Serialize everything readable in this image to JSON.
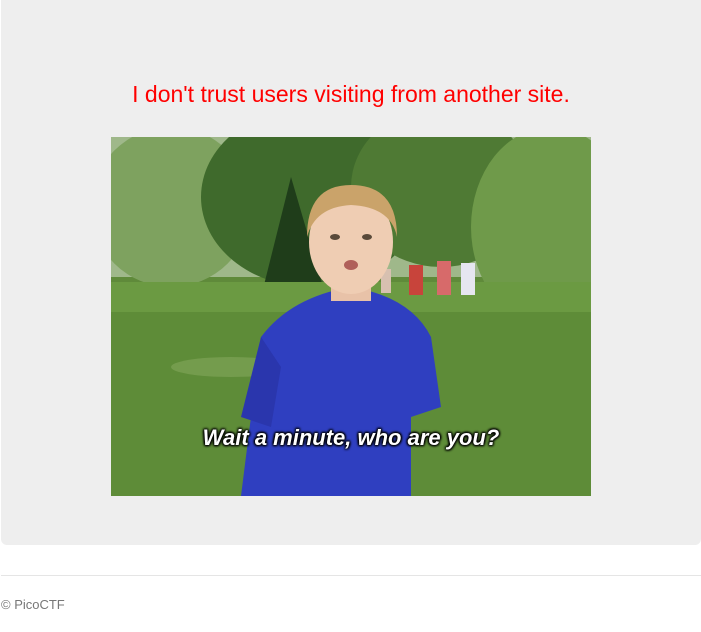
{
  "main": {
    "message": "I don't trust users visiting from another site.",
    "message_color": "#ff0000",
    "image": {
      "subject": "boy in blue t-shirt standing in a grassy field, other kids in background",
      "caption": "Wait a minute, who are you?"
    }
  },
  "footer": {
    "text": "© PicoCTF"
  },
  "colors": {
    "panel_bg": "#eeeeee",
    "footer_text": "#777777"
  }
}
